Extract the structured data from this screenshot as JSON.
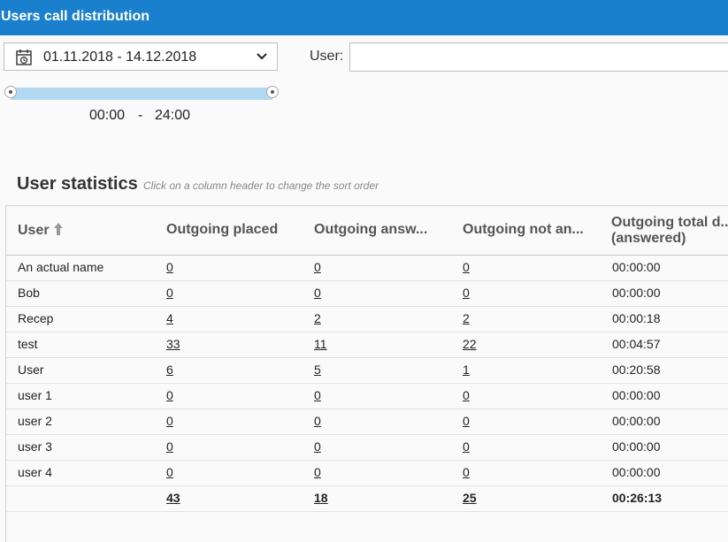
{
  "header": {
    "title": "Users call distribution"
  },
  "filters": {
    "date_range": "01.11.2018 - 14.12.2018",
    "user_label": "User:",
    "user_value": "",
    "time_from": "00:00",
    "time_sep": "-",
    "time_to": "24:00",
    "time_range_fraction": [
      0,
      1
    ]
  },
  "stats": {
    "title": "User statistics",
    "hint": "Click on a column header to change the sort order",
    "columns": [
      "User",
      "Outgoing placed",
      "Outgoing answ...",
      "Outgoing not an...",
      "Outgoing total d...",
      "(answered)"
    ],
    "rows": [
      {
        "user": "An actual name",
        "placed": "0",
        "answered": "0",
        "not_answered": "0",
        "duration": "00:00:00"
      },
      {
        "user": "Bob",
        "placed": "0",
        "answered": "0",
        "not_answered": "0",
        "duration": "00:00:00"
      },
      {
        "user": "Recep",
        "placed": "4",
        "answered": "2",
        "not_answered": "2",
        "duration": "00:00:18"
      },
      {
        "user": "test",
        "placed": "33",
        "answered": "11",
        "not_answered": "22",
        "duration": "00:04:57"
      },
      {
        "user": "User",
        "placed": "6",
        "answered": "5",
        "not_answered": "1",
        "duration": "00:20:58"
      },
      {
        "user": "user 1",
        "placed": "0",
        "answered": "0",
        "not_answered": "0",
        "duration": "00:00:00"
      },
      {
        "user": "user 2",
        "placed": "0",
        "answered": "0",
        "not_answered": "0",
        "duration": "00:00:00"
      },
      {
        "user": "user 3",
        "placed": "0",
        "answered": "0",
        "not_answered": "0",
        "duration": "00:00:00"
      },
      {
        "user": "user 4",
        "placed": "0",
        "answered": "0",
        "not_answered": "0",
        "duration": "00:00:00"
      }
    ],
    "totals": {
      "placed": "43",
      "answered": "18",
      "not_answered": "25",
      "duration": "00:26:13"
    }
  },
  "colors": {
    "accent": "#1a7fcc",
    "slider_fill": "#b3d9f2"
  }
}
